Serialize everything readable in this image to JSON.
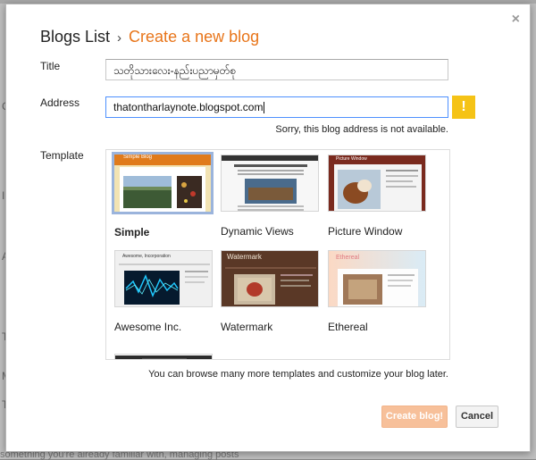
{
  "background": {
    "letters": [
      "C",
      "I",
      "A",
      "T",
      "M",
      "T"
    ],
    "footer_text": "something you're already familiar with, managing posts"
  },
  "dialog": {
    "close_glyph": "×",
    "breadcrumb": {
      "root": "Blogs List",
      "separator": "›",
      "current": "Create a new blog"
    },
    "title_field": {
      "label": "Title",
      "value": "သတိုသားလေး-နည်းပညာမှတ်စု"
    },
    "address_field": {
      "label": "Address",
      "value": "thatontharlaynote.blogspot.com",
      "warning_glyph": "!",
      "error": "Sorry, this blog address is not available."
    },
    "template_section": {
      "label": "Template",
      "items": [
        {
          "name": "Simple",
          "selected": true
        },
        {
          "name": "Dynamic Views",
          "selected": false
        },
        {
          "name": "Picture Window",
          "selected": false
        },
        {
          "name": "Awesome Inc.",
          "selected": false
        },
        {
          "name": "Watermark",
          "selected": false
        },
        {
          "name": "Ethereal",
          "selected": false
        }
      ],
      "thumb_labels": {
        "simple": "Simple Blog",
        "picture_window": "Picture Window",
        "awesome": "Awesome, Incorporation",
        "watermark": "Watermark",
        "ethereal": "Ethereal"
      },
      "browse_note": "You can browse many more templates and customize your blog later."
    },
    "buttons": {
      "create": "Create blog!",
      "cancel": "Cancel"
    },
    "colors": {
      "accent_orange": "#e8751a",
      "warning_yellow": "#f5c316",
      "create_button": "#f7c09a"
    }
  }
}
